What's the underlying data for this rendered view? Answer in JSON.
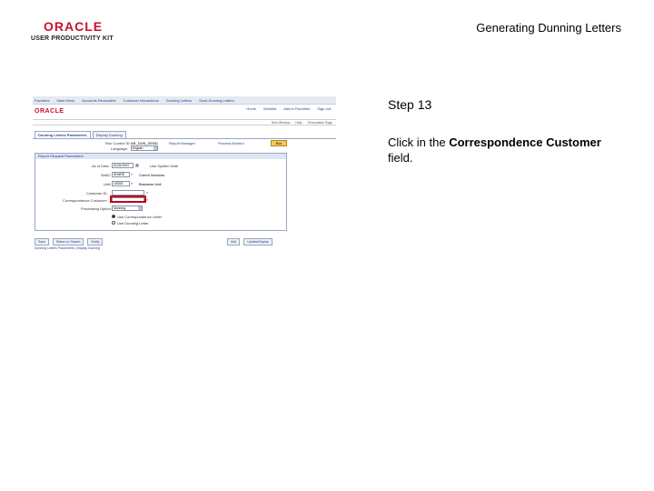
{
  "header": {
    "logo_brand": "ORACLE",
    "logo_product": "USER PRODUCTIVITY KIT",
    "slide_title": "Generating Dunning Letters"
  },
  "screenshot": {
    "nav": [
      "Favorites",
      "Main Menu",
      "Accounts Receivable",
      "Customer Interactions",
      "Dunning Letters",
      "Send Dunning Letters"
    ],
    "brand": "ORACLE",
    "top_links": [
      "Home",
      "Worklist",
      "Add to Favorites",
      "Sign out"
    ],
    "bar_links": [
      "New Window",
      "Help",
      "Personalize Page"
    ],
    "tabs": [
      "Dunning Letters Parameters",
      "Display Dunning"
    ],
    "run_control_label": "Run Control ID:",
    "run_control_value": "AR_DUN_SEND",
    "report_manager": "Report Manager",
    "process_monitor": "Process Monitor",
    "run_button": "Run",
    "language_label": "Language:",
    "language_value": "English",
    "group_title": "Report Request Parameters",
    "as_of_date_label": "As of Date:",
    "as_of_date_value": "01/31/2007",
    "as_of_date_check": "Use System Date",
    "setid_label": "SetID:",
    "setid_value": "SHARE",
    "setid_desc": "Comm Services",
    "unit_label": "Unit:",
    "unit_value": "US001",
    "unit_desc": "Business Unit",
    "customer_label": "Customer ID:",
    "correspondence_label": "Correspondence Customer:",
    "processing_label": "Processing Option:",
    "processing_value": "Dunning",
    "radio_1": "Use Correspondence Letter",
    "radio_2": "Use Dunning Letter",
    "save_btn": "Save",
    "return_btn": "Return to Search",
    "notify_btn": "Notify",
    "add_btn": "Add",
    "update_btn": "Update/Display",
    "footer": "Dunning Letters Parameters | Display Dunning"
  },
  "step": {
    "title": "Step 13",
    "instruction_prefix": "Click in the ",
    "instruction_bold": "Correspondence Customer",
    "instruction_suffix": " field."
  }
}
